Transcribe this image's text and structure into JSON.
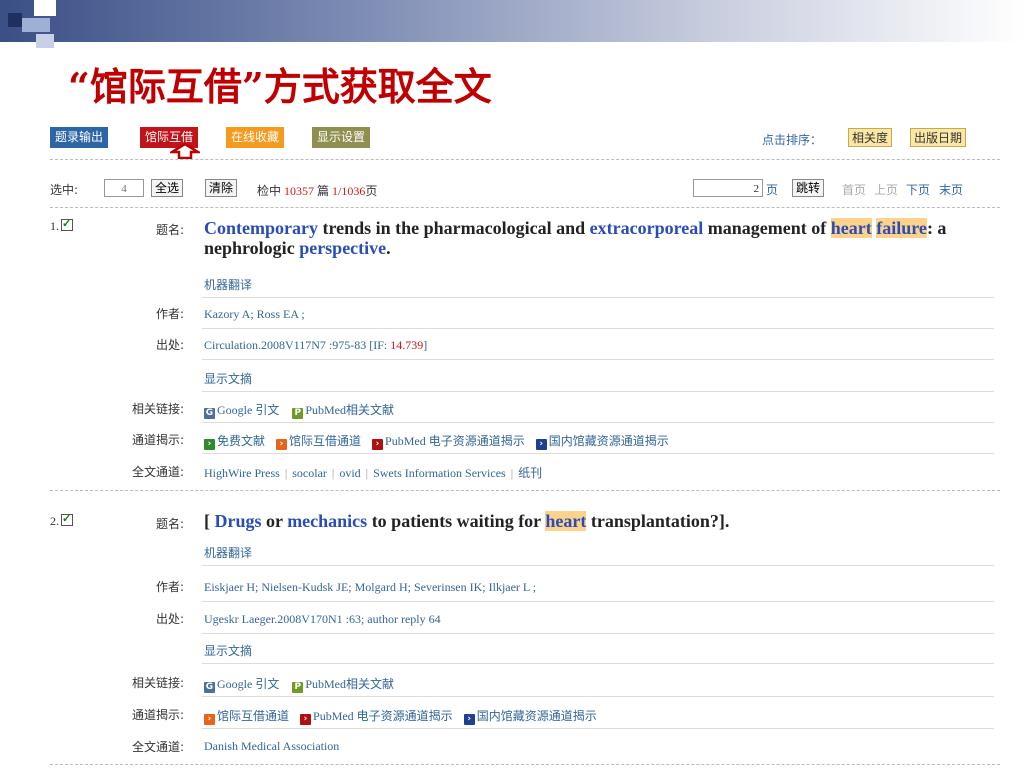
{
  "slide_title": "“馆际互借”方式获取全文",
  "toolbar": {
    "buttons": [
      "题录输出",
      "馆际互借",
      "在线收藏",
      "显示设置"
    ],
    "sort_label": "点击排序：",
    "sort_options": [
      "相关度",
      "出版日期"
    ]
  },
  "pager": {
    "selected_label": "选中:",
    "selected_count": "4",
    "select_all": "全选",
    "clear": "清除",
    "hits_prefix": "检中",
    "hits_count": "10357",
    "hits_unit": "篇",
    "page_info": "1/1036",
    "page_suffix": "页",
    "goto_value": "2",
    "goto_suffix": "页",
    "goto_button": "跳转",
    "first": "首页",
    "prev": "上页",
    "next": "下页",
    "last": "末页"
  },
  "labels": {
    "title": "题名:",
    "author": "作者:",
    "source": "出处:",
    "links": "相关链接:",
    "channels": "通道揭示:",
    "fulltext": "全文通道:"
  },
  "records": [
    {
      "num": "1.",
      "title_parts": [
        {
          "t": "Contemporary",
          "s": "kw"
        },
        {
          "t": " trends in the pharmacological and ",
          "s": ""
        },
        {
          "t": "extracorporeal",
          "s": "kw"
        },
        {
          "t": " management of ",
          "s": ""
        },
        {
          "t": "heart",
          "s": "hl"
        },
        {
          "t": " ",
          "s": ""
        },
        {
          "t": "failure",
          "s": "hl"
        },
        {
          "t": ": a nephrologic ",
          "s": ""
        },
        {
          "t": "perspective",
          "s": "kw"
        },
        {
          "t": ".",
          "s": ""
        }
      ],
      "translate": "机器翻译",
      "authors": "Kazory A;  Ross EA ;",
      "source": "Circulation.2008V117N7 :975-83   [IF:",
      "impact_factor": "14.739",
      "source_end": "]",
      "abstract": "显示文摘",
      "links": [
        "Google 引文",
        "PubMed相关文献"
      ],
      "channels": [
        {
          "text": "免费文献",
          "color": "#2e8b2e"
        },
        {
          "text": "馆际互借通道",
          "color": "#e7651a"
        },
        {
          "text": "PubMed 电子资源通道揭示",
          "color": "#b01010"
        },
        {
          "text": "国内馆藏资源通道揭示",
          "color": "#1f3f8f"
        }
      ],
      "fulltext": [
        "HighWire Press",
        "socolar",
        "ovid",
        "Swets Information Services",
        "纸刊"
      ]
    },
    {
      "num": "2.",
      "title_parts": [
        {
          "t": "[ ",
          "s": ""
        },
        {
          "t": "Drugs",
          "s": "kw"
        },
        {
          "t": " or ",
          "s": ""
        },
        {
          "t": "mechanics",
          "s": "kw"
        },
        {
          "t": " to patients waiting for ",
          "s": ""
        },
        {
          "t": "heart",
          "s": "hl"
        },
        {
          "t": " transplantation?].",
          "s": ""
        }
      ],
      "translate": "机器翻译",
      "authors": "Eiskjaer H;  Nielsen-Kudsk JE;  Molgard H;  Severinsen IK;  Ilkjaer L ;",
      "source": "Ugeskr Laeger.2008V170N1 :63; author reply 64",
      "abstract": "显示文摘",
      "links": [
        "Google 引文",
        "PubMed相关文献"
      ],
      "channels": [
        {
          "text": "馆际互借通道",
          "color": "#e7651a"
        },
        {
          "text": "PubMed 电子资源通道揭示",
          "color": "#b01010"
        },
        {
          "text": "国内馆藏资源通道揭示",
          "color": "#1f3f8f"
        }
      ],
      "fulltext": [
        "Danish Medical Association"
      ]
    }
  ]
}
